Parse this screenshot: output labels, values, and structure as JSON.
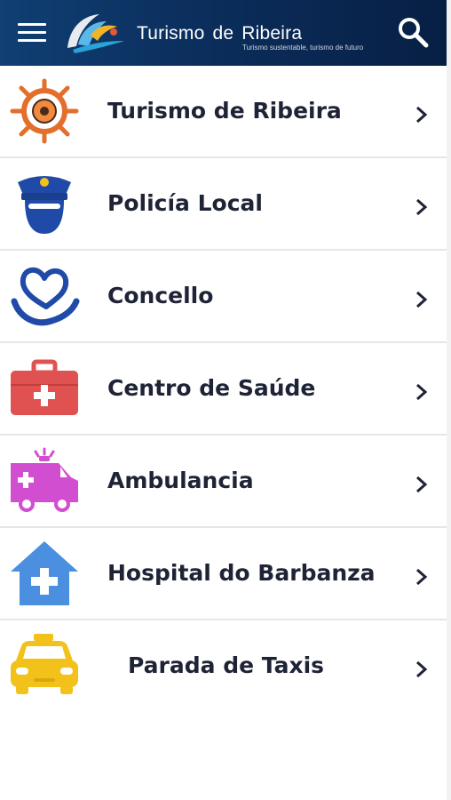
{
  "header": {
    "brand_title": "Turismo de Ribeira",
    "brand_tagline": "Turismo sustentable, turismo de futuro",
    "menu_icon": "hamburger-menu-icon",
    "search_icon": "search-icon",
    "background_color": "#0b2e5c"
  },
  "list": {
    "items": [
      {
        "label": "Turismo de Ribeira",
        "icon": "ship-wheel-icon",
        "icon_color": "#e26f2c"
      },
      {
        "label": "Policía Local",
        "icon": "police-officer-icon",
        "icon_color": "#1f4aa8"
      },
      {
        "label": "Concello",
        "icon": "heart-hand-icon",
        "icon_color": "#1f4aa8"
      },
      {
        "label": "Centro de Saúde",
        "icon": "first-aid-kit-icon",
        "icon_color": "#e05252"
      },
      {
        "label": "Ambulancia",
        "icon": "ambulance-icon",
        "icon_color": "#d24ed0"
      },
      {
        "label": "Hospital do Barbanza",
        "icon": "hospital-house-icon",
        "icon_color": "#4a8fe0"
      },
      {
        "label": "Parada de Taxis",
        "icon": "taxi-icon",
        "icon_color": "#f2c21b"
      }
    ],
    "chevron_icon": "chevron-right-icon"
  }
}
